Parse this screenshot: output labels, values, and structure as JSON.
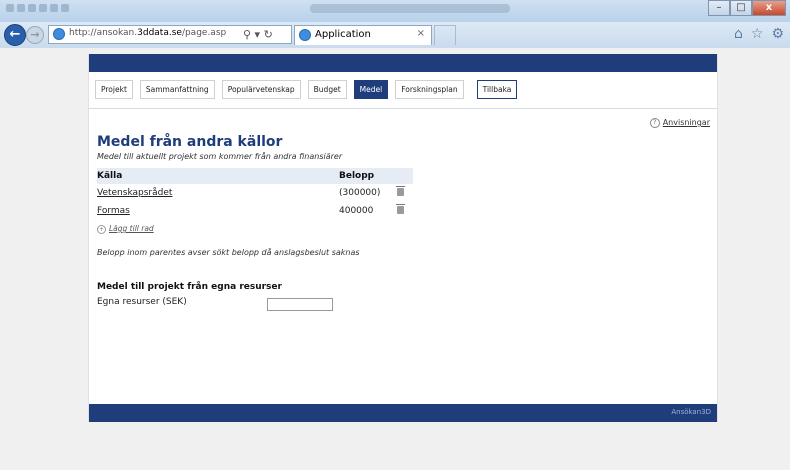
{
  "browser": {
    "url_prefix": "http://ansokan.",
    "url_domain": "3ddata.se",
    "url_suffix": "/page.asp",
    "tab_title": "Application",
    "tab_close": "×"
  },
  "menu": {
    "items": [
      {
        "label": "Projekt",
        "active": false
      },
      {
        "label": "Sammanfattning",
        "active": false
      },
      {
        "label": "Populärvetenskap",
        "active": false
      },
      {
        "label": "Budget",
        "active": false
      },
      {
        "label": "Medel",
        "active": true
      },
      {
        "label": "Forskningsplan",
        "active": false
      }
    ],
    "back_label": "Tillbaka"
  },
  "help_label": "Anvisningar",
  "page": {
    "title": "Medel från andra källor",
    "subtitle": "Medel till aktuellt projekt som kommer från andra finansiärer",
    "table": {
      "headers": [
        "Källa",
        "Belopp"
      ],
      "rows": [
        {
          "source": "Vetenskapsrådet",
          "amount": "(300000)"
        },
        {
          "source": "Formas",
          "amount": "400000"
        }
      ]
    },
    "add_row": "Lägg till rad",
    "note": "Belopp inom parentes avser sökt belopp då anslagsbeslut saknas",
    "own_section_title": "Medel till projekt från egna resurser",
    "own_field_label": "Egna resurser (SEK)",
    "own_field_value": ""
  },
  "footer": "Ansökan3D",
  "colors": {
    "brand": "#1e3d7a",
    "header_row": "#e6ecf6"
  }
}
